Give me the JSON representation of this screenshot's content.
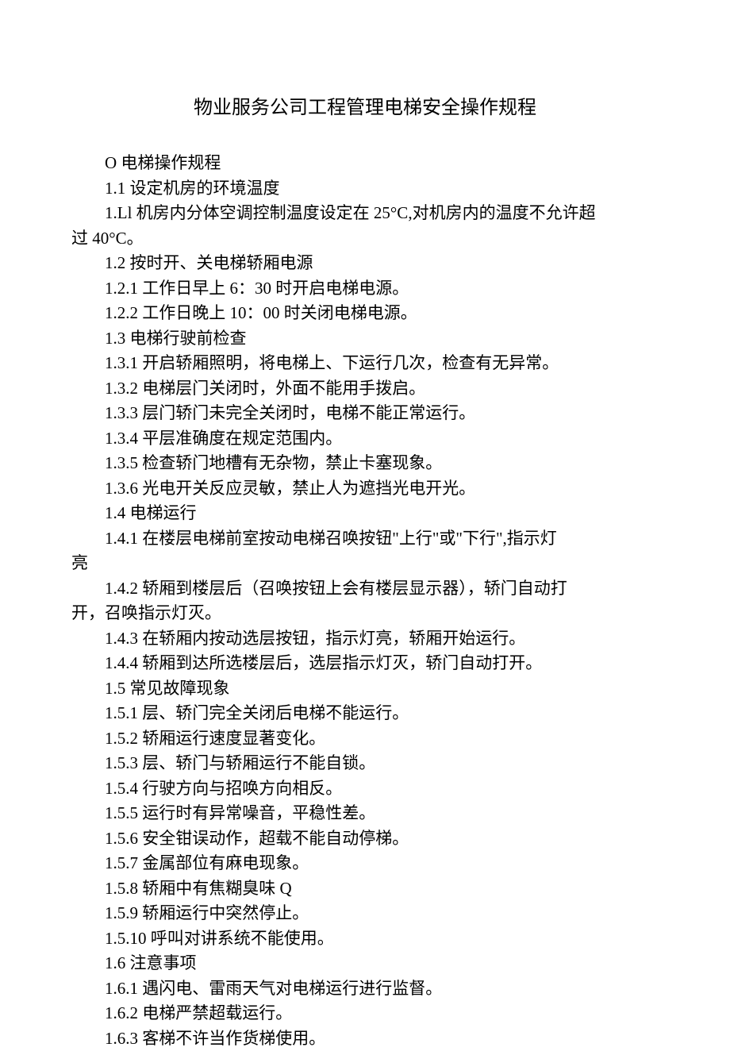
{
  "title": "物业服务公司工程管理电梯安全操作规程",
  "lines": [
    "O 电梯操作规程",
    "1.1 设定机房的环境温度",
    "1.Ll 机房内分体空调控制温度设定在 25°C,对机房内的温度不允许超",
    "过 40°C。",
    "1.2 按时开、关电梯轿厢电源",
    "1.2.1 工作日早上 6：30 时开启电梯电源。",
    "1.2.2 工作日晚上 10：00 时关闭电梯电源。",
    "1.3 电梯行驶前检查",
    "1.3.1 开启轿厢照明，将电梯上、下运行几次，检查有无异常。",
    "1.3.2 电梯层门关闭时，外面不能用手拨启。",
    "1.3.3 层门轿门未完全关闭时，电梯不能正常运行。",
    "1.3.4 平层准确度在规定范围内。",
    "1.3.5 检查轿门地槽有无杂物，禁止卡塞现象。",
    "1.3.6 光电开关反应灵敏，禁止人为遮挡光电开光。",
    "1.4 电梯运行",
    "1.4.1 在楼层电梯前室按动电梯召唤按钮\"上行\"或\"下行\",指示灯",
    "亮",
    "1.4.2 轿厢到楼层后（召唤按钮上会有楼层显示器），轿门自动打",
    "开，召唤指示灯灭。",
    "1.4.3 在轿厢内按动选层按钮，指示灯亮，轿厢开始运行。",
    "1.4.4 轿厢到达所选楼层后，选层指示灯灭，轿门自动打开。",
    "1.5 常见故障现象",
    "1.5.1 层、轿门完全关闭后电梯不能运行。",
    "1.5.2 轿厢运行速度显著变化。",
    "1.5.3 层、轿门与轿厢运行不能自锁。",
    "1.5.4 行驶方向与招唤方向相反。",
    "1.5.5 运行时有异常噪音，平稳性差。",
    "1.5.6 安全钳误动作，超载不能自动停梯。",
    "1.5.7 金属部位有麻电现象。",
    "1.5.8 轿厢中有焦糊臭味 Q",
    "1.5.9 轿厢运行中突然停止。",
    "1.5.10 呼叫对讲系统不能使用。",
    "1.6 注意事项",
    "1.6.1 遇闪电、雷雨天气对电梯运行进行监督。",
    "1.6.2 电梯严禁超载运行。",
    "1.6.3 客梯不许当作货梯使用。"
  ],
  "noIndentLines": [
    3,
    16,
    18
  ]
}
